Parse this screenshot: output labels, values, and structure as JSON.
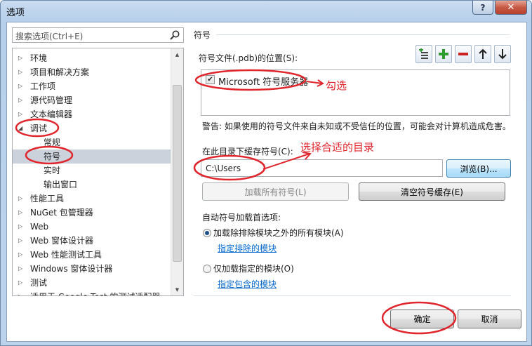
{
  "window": {
    "title": "选项",
    "help_glyph": "?",
    "close_glyph": "✕"
  },
  "search": {
    "placeholder": "搜索选项(Ctrl+E)"
  },
  "tree": {
    "items": [
      {
        "label": "环境",
        "expanded": false
      },
      {
        "label": "项目和解决方案",
        "expanded": false
      },
      {
        "label": "工作项",
        "expanded": false
      },
      {
        "label": "源代码管理",
        "expanded": false
      },
      {
        "label": "文本编辑器",
        "expanded": false
      },
      {
        "label": "调试",
        "expanded": true
      },
      {
        "label": "常规",
        "child": true
      },
      {
        "label": "符号",
        "child": true,
        "selected": true
      },
      {
        "label": "实时",
        "child": true
      },
      {
        "label": "输出窗口",
        "child": true
      },
      {
        "label": "性能工具",
        "expanded": false
      },
      {
        "label": "NuGet 包管理器",
        "expanded": false
      },
      {
        "label": "Web",
        "expanded": false
      },
      {
        "label": "Web 窗体设计器",
        "expanded": false
      },
      {
        "label": "Web 性能测试工具",
        "expanded": false
      },
      {
        "label": "Windows 窗体设计器",
        "expanded": false
      },
      {
        "label": "测试",
        "expanded": false
      },
      {
        "label": "适用于 Google Test 的测试适配器",
        "expanded": false
      }
    ]
  },
  "page": {
    "section_title": "符号",
    "locations_label": "符号文件(.pdb)的位置(S):",
    "toolbar_icons": [
      "add-location-icon",
      "add-icon",
      "remove-icon",
      "move-up-icon",
      "move-down-icon"
    ],
    "locations": [
      {
        "label": "Microsoft 符号服务器",
        "checked": true
      }
    ],
    "warning": "警告: 如果使用的符号文件来自未知或不受信任的位置，可能会对计算机造成危害。",
    "cache_label": "在此目录下缓存符号(C):",
    "cache_path": "C:\\Users",
    "browse_button": "浏览(B)...",
    "load_all_button": "加载所有符号(L)",
    "clear_cache_button": "清空符号缓存(E)",
    "auto_load_label": "自动符号加载首选项:",
    "radio_all": "加载除排除模块之外的所有模块(A)",
    "link_excluded": "指定排除的模块",
    "radio_specified": "仅加载指定的模块(O)",
    "link_included": "指定包含的模块",
    "selected_option": "radio_all"
  },
  "footer": {
    "ok_button": "确定",
    "cancel_button": "取消"
  },
  "annotations": {
    "check_note": "勾选",
    "dir_note": "选择合适的目录",
    "color": "#e0262c"
  }
}
